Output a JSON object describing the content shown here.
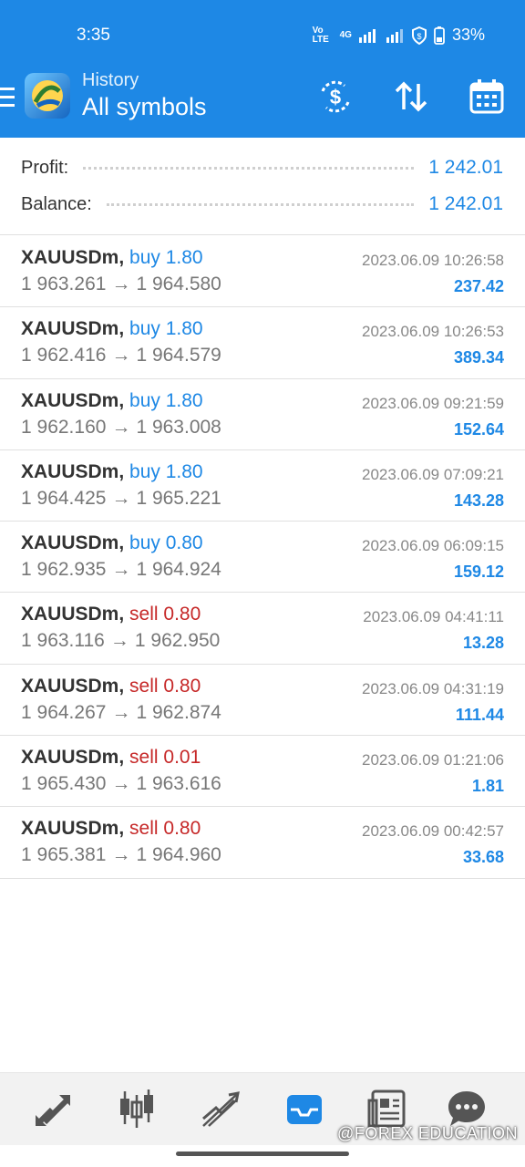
{
  "status_bar": {
    "time": "3:35",
    "network": "Vo LTE",
    "signal": "4G",
    "battery": "33%"
  },
  "header": {
    "subtitle": "History",
    "title": "All symbols",
    "icons": [
      "menu-icon",
      "metatrader-logo",
      "dollar-refresh-icon",
      "sort-icon",
      "calendar-icon"
    ]
  },
  "summary": {
    "profit_label": "Profit:",
    "profit_value": "1 242.01",
    "balance_label": "Balance:",
    "balance_value": "1 242.01"
  },
  "trades": [
    {
      "symbol": "XAUUSDm,",
      "side": "buy",
      "volume": "1.80",
      "open": "1 963.261",
      "close": "1 964.580",
      "time": "2023.06.09 10:26:58",
      "profit": "237.42"
    },
    {
      "symbol": "XAUUSDm,",
      "side": "buy",
      "volume": "1.80",
      "open": "1 962.416",
      "close": "1 964.579",
      "time": "2023.06.09 10:26:53",
      "profit": "389.34"
    },
    {
      "symbol": "XAUUSDm,",
      "side": "buy",
      "volume": "1.80",
      "open": "1 962.160",
      "close": "1 963.008",
      "time": "2023.06.09 09:21:59",
      "profit": "152.64"
    },
    {
      "symbol": "XAUUSDm,",
      "side": "buy",
      "volume": "1.80",
      "open": "1 964.425",
      "close": "1 965.221",
      "time": "2023.06.09 07:09:21",
      "profit": "143.28"
    },
    {
      "symbol": "XAUUSDm,",
      "side": "buy",
      "volume": "0.80",
      "open": "1 962.935",
      "close": "1 964.924",
      "time": "2023.06.09 06:09:15",
      "profit": "159.12"
    },
    {
      "symbol": "XAUUSDm,",
      "side": "sell",
      "volume": "0.80",
      "open": "1 963.116",
      "close": "1 962.950",
      "time": "2023.06.09 04:41:11",
      "profit": "13.28"
    },
    {
      "symbol": "XAUUSDm,",
      "side": "sell",
      "volume": "0.80",
      "open": "1 964.267",
      "close": "1 962.874",
      "time": "2023.06.09 04:31:19",
      "profit": "111.44"
    },
    {
      "symbol": "XAUUSDm,",
      "side": "sell",
      "volume": "0.01",
      "open": "1 965.430",
      "close": "1 963.616",
      "time": "2023.06.09 01:21:06",
      "profit": "1.81"
    },
    {
      "symbol": "XAUUSDm,",
      "side": "sell",
      "volume": "0.80",
      "open": "1 965.381",
      "close": "1 964.960",
      "time": "2023.06.09 00:42:57",
      "profit": "33.68"
    }
  ],
  "bottom_nav": [
    "quotes-icon",
    "chart-icon",
    "trade-icon",
    "history-icon",
    "news-icon",
    "chat-icon"
  ],
  "active_tab": "history-icon",
  "watermark": "@FOREX EDUCATION",
  "colors": {
    "appbar": "#1e88e5",
    "buy": "#1e88e5",
    "sell": "#c62828",
    "profit": "#1e88e5"
  }
}
